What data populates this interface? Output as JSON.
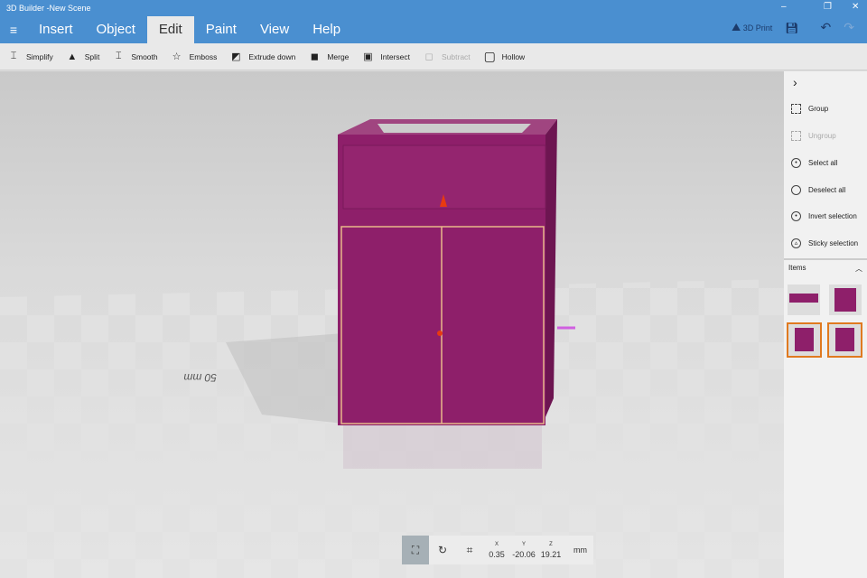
{
  "window": {
    "title": "3D Builder -New Scene",
    "minimize": "–",
    "restore": "❐",
    "close": "✕"
  },
  "menu": {
    "tabs": [
      "Insert",
      "Object",
      "Edit",
      "Paint",
      "View",
      "Help"
    ],
    "active": "Edit"
  },
  "actions": {
    "print": "3D Print"
  },
  "toolbar": [
    {
      "label": "Simplify",
      "icon": "⌶"
    },
    {
      "label": "Split",
      "icon": "▲"
    },
    {
      "label": "Smooth",
      "icon": "⌶"
    },
    {
      "label": "Emboss",
      "icon": "☆"
    },
    {
      "label": "Extrude down",
      "icon": "◩"
    },
    {
      "label": "Merge",
      "icon": "◼"
    },
    {
      "label": "Intersect",
      "icon": "▣"
    },
    {
      "label": "Subtract",
      "icon": "◻"
    },
    {
      "label": "Hollow",
      "icon": "▢"
    }
  ],
  "panel": {
    "items": [
      {
        "label": "Group"
      },
      {
        "label": "Ungroup"
      },
      {
        "label": "Select all"
      },
      {
        "label": "Deselect all"
      },
      {
        "label": "Invert selection"
      },
      {
        "label": "Sticky selection"
      }
    ],
    "items_header": "Items"
  },
  "scene": {
    "scale_label": "50 mm",
    "object_color": "#8e1f6a"
  },
  "coords": {
    "x_label": "X",
    "y_label": "Y",
    "z_label": "Z",
    "x": "0.35",
    "y": "-20.06",
    "z": "19.21",
    "unit": "mm"
  }
}
